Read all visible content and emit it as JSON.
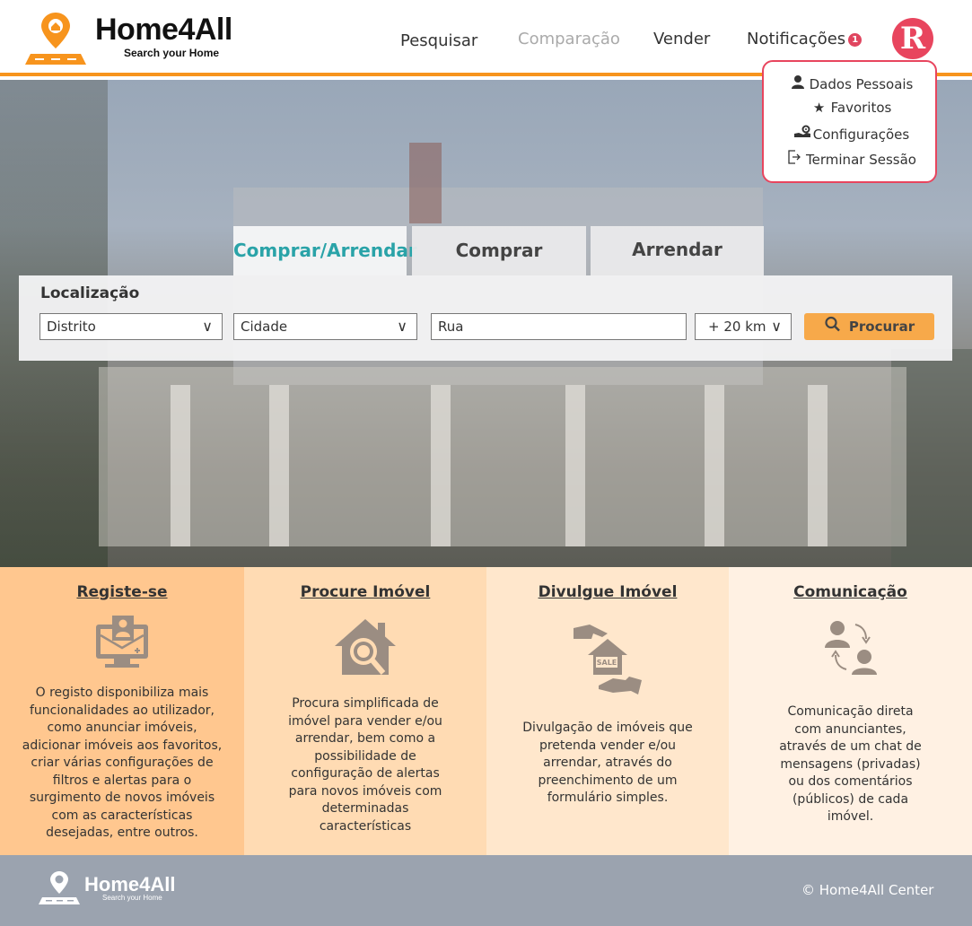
{
  "brand": {
    "name": "Home4All",
    "tagline": "Search your Home"
  },
  "nav": {
    "search": "Pesquisar",
    "compare": "Comparação",
    "sell": "Vender",
    "notifications": "Notificações",
    "notification_count": "1"
  },
  "user": {
    "avatar_initial": "R",
    "menu": [
      {
        "label": "Dados Pessoais",
        "icon": "user-icon"
      },
      {
        "label": "Favoritos",
        "icon": "star-icon"
      },
      {
        "label": "Configurações",
        "icon": "settings-hand-icon"
      },
      {
        "label": "Terminar Sessão",
        "icon": "logout-icon"
      }
    ]
  },
  "search": {
    "tabs": [
      "Comprar/Arrendar",
      "Comprar",
      "Arrendar"
    ],
    "active_tab": "Comprar/Arrendar",
    "location_label": "Localização",
    "district": "Distrito",
    "city": "Cidade",
    "street": "Rua",
    "radius": "+ 20 km",
    "button": "Procurar"
  },
  "features": [
    {
      "title": "Registe-se",
      "icon": "register-computer-icon",
      "bg": "#ffc78f",
      "description": "O registo disponibiliza mais funcionalidades ao utilizador, como anunciar imóveis, adicionar imóveis aos favoritos, criar várias configurações de filtros e alertas para o surgimento de novos imóveis com as características desejadas, entre outros."
    },
    {
      "title": "Procure Imóvel",
      "icon": "house-search-icon",
      "bg": "#ffdbb3",
      "description": "Procura simplificada de imóvel para vender e/ou arrendar, bem como a possibilidade de configuração de alertas para novos imóveis com determinadas características"
    },
    {
      "title": "Divulgue Imóvel",
      "icon": "house-sale-icon",
      "bg": "#ffe7cc",
      "description": "Divulgação de imóveis que pretenda vender e/ou arrendar, através do preenchimento de um formulário simples."
    },
    {
      "title": "Comunicação",
      "icon": "communication-icon",
      "bg": "#fff1e3",
      "description": "Comunicação direta com anunciantes, através de um chat de mensagens (privadas) ou dos comentários (públicos) de cada imóvel."
    }
  ],
  "footer": {
    "copyright": "© Home4All Center"
  },
  "colors": {
    "accent": "#f7941d",
    "avatar": "#e8455e",
    "active_tab": "#2aa3a8",
    "search_button": "#f7a94a",
    "footer": "#9ba3af"
  }
}
